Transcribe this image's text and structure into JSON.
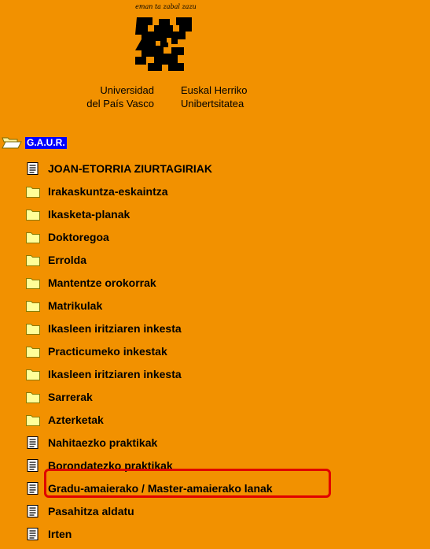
{
  "header": {
    "motto": "eman ta zabal zazu",
    "university_es_line1": "Universidad",
    "university_es_line2": "del País Vasco",
    "university_eu_line1": "Euskal Herriko",
    "university_eu_line2": "Unibertsitatea"
  },
  "tree": {
    "root_label": "G.A.U.R.",
    "items": [
      {
        "label": "JOAN-ETORRIA ZIURTAGIRIAK",
        "icon": "document-icon"
      },
      {
        "label": "Irakaskuntza-eskaintza",
        "icon": "folder-icon"
      },
      {
        "label": "Ikasketa-planak",
        "icon": "folder-icon"
      },
      {
        "label": "Doktoregoa",
        "icon": "folder-icon"
      },
      {
        "label": "Errolda",
        "icon": "folder-icon"
      },
      {
        "label": "Mantentze orokorrak",
        "icon": "folder-icon"
      },
      {
        "label": "Matrikulak",
        "icon": "folder-icon"
      },
      {
        "label": "Ikasleen iritziaren inkesta",
        "icon": "folder-icon"
      },
      {
        "label": "Practicumeko inkestak",
        "icon": "folder-icon"
      },
      {
        "label": "Ikasleen iritziaren inkesta",
        "icon": "folder-icon"
      },
      {
        "label": "Sarrerak",
        "icon": "folder-icon"
      },
      {
        "label": "Azterketak",
        "icon": "folder-icon"
      },
      {
        "label": "Nahitaezko praktikak",
        "icon": "document-icon"
      },
      {
        "label": "Borondatezko praktikak",
        "icon": "document-icon"
      },
      {
        "label": "Gradu-amaierako / Master-amaierako lanak",
        "icon": "document-icon"
      },
      {
        "label": "Pasahitza aldatu",
        "icon": "document-icon"
      },
      {
        "label": "Irten",
        "icon": "document-icon"
      }
    ]
  },
  "colors": {
    "background": "#f29100",
    "root_highlight": "#0000ff",
    "annotation_box": "#e00000"
  }
}
